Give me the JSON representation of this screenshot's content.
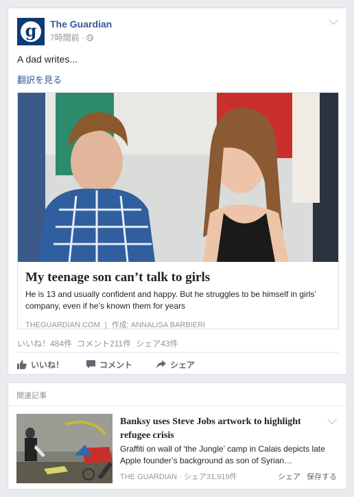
{
  "post": {
    "page_name": "The Guardian",
    "avatar_letter": "g",
    "timestamp": "7時間前",
    "separator": "·",
    "text": "A dad writes...",
    "translate_label": "翻訳を見る",
    "link": {
      "title": "My teenage son can’t talk to girls",
      "description": "He is 13 and usually confident and happy. But he struggles to be himself in girls’ company, even if he’s known them for years",
      "source": "theguardian.com",
      "source_sep": "|",
      "author": "作成: ANNALISA BARBIERI"
    },
    "stats": {
      "likes": "いいね！484件",
      "comments": "コメント211件",
      "shares": "シェア43件"
    },
    "actions": {
      "like": "いいね！",
      "comment": "コメント",
      "share": "シェア"
    }
  },
  "related": {
    "header": "関連記事",
    "title": "Banksy uses Steve Jobs artwork to highlight refugee crisis",
    "description": "Graffiti on wall of ‘the Jungle’ camp in Calais depicts late Apple founder’s background as son of Syrian…",
    "source": "THE GUARDIAN · シェア31,919件",
    "share_label": "シェア",
    "save_label": "保存する"
  },
  "colors": {
    "brand": "#0b3a74",
    "link": "#365899",
    "muted": "#90949c",
    "background": "#e9ebee"
  }
}
